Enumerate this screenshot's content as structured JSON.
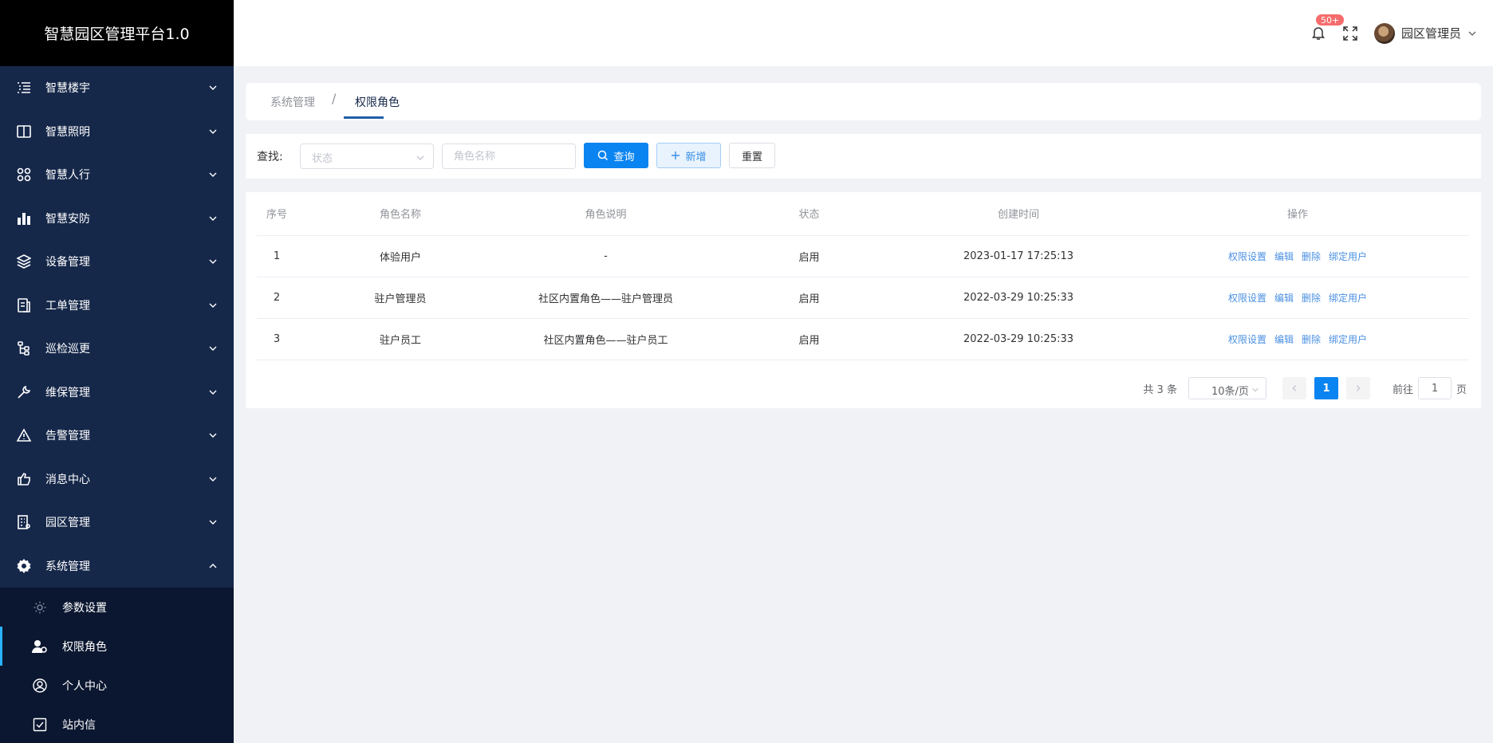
{
  "sidebar": {
    "title": "智慧园区管理平台1.0",
    "items": [
      {
        "label": "智慧楼宇",
        "icon": "list-icon"
      },
      {
        "label": "智慧照明",
        "icon": "book-icon"
      },
      {
        "label": "智慧人行",
        "icon": "grid-icon"
      },
      {
        "label": "智慧安防",
        "icon": "bar-chart-icon"
      },
      {
        "label": "设备管理",
        "icon": "layers-icon"
      },
      {
        "label": "工单管理",
        "icon": "document-icon"
      },
      {
        "label": "巡检巡更",
        "icon": "route-icon"
      },
      {
        "label": "维保管理",
        "icon": "wrench-icon"
      },
      {
        "label": "告警管理",
        "icon": "warning-icon"
      },
      {
        "label": "消息中心",
        "icon": "message-icon"
      },
      {
        "label": "园区管理",
        "icon": "building-icon"
      },
      {
        "label": "系统管理",
        "icon": "gear-icon"
      }
    ],
    "subitems": [
      {
        "label": "参数设置",
        "icon": "settings-icon"
      },
      {
        "label": "权限角色",
        "icon": "user-role-icon"
      },
      {
        "label": "个人中心",
        "icon": "user-circle-icon"
      },
      {
        "label": "站内信",
        "icon": "checkbox-icon"
      }
    ]
  },
  "header": {
    "badge": "50+",
    "username": "园区管理员"
  },
  "breadcrumb": {
    "parent": "系统管理",
    "separator": "/",
    "current": "权限角色"
  },
  "filter": {
    "label": "查找:",
    "status_placeholder": "状态",
    "role_placeholder": "角色名称",
    "query_label": "查询",
    "add_label": "新增",
    "reset_label": "重置"
  },
  "table": {
    "headers": [
      "序号",
      "角色名称",
      "角色说明",
      "状态",
      "创建时间",
      "操作"
    ],
    "rows": [
      [
        "1",
        "体验用户",
        "-",
        "启用",
        "2023-01-17 17:25:13"
      ],
      [
        "2",
        "驻户管理员",
        "社区内置角色——驻户管理员",
        "启用",
        "2022-03-29 10:25:33"
      ],
      [
        "3",
        "驻户员工",
        "社区内置角色——驻户员工",
        "启用",
        "2022-03-29 10:25:33"
      ]
    ],
    "actions": [
      "权限设置",
      "编辑",
      "删除",
      "绑定用户"
    ]
  },
  "pagination": {
    "total": "共 3 条",
    "page_size": "10条/页",
    "current_page": "1",
    "goto_label": "前往",
    "goto_value": "1",
    "page_suffix": "页"
  },
  "colors": {
    "sidebar_bg": "#16284a",
    "primary": "#0a84f0",
    "link": "#4a90e2",
    "badge": "#f56c6c"
  }
}
